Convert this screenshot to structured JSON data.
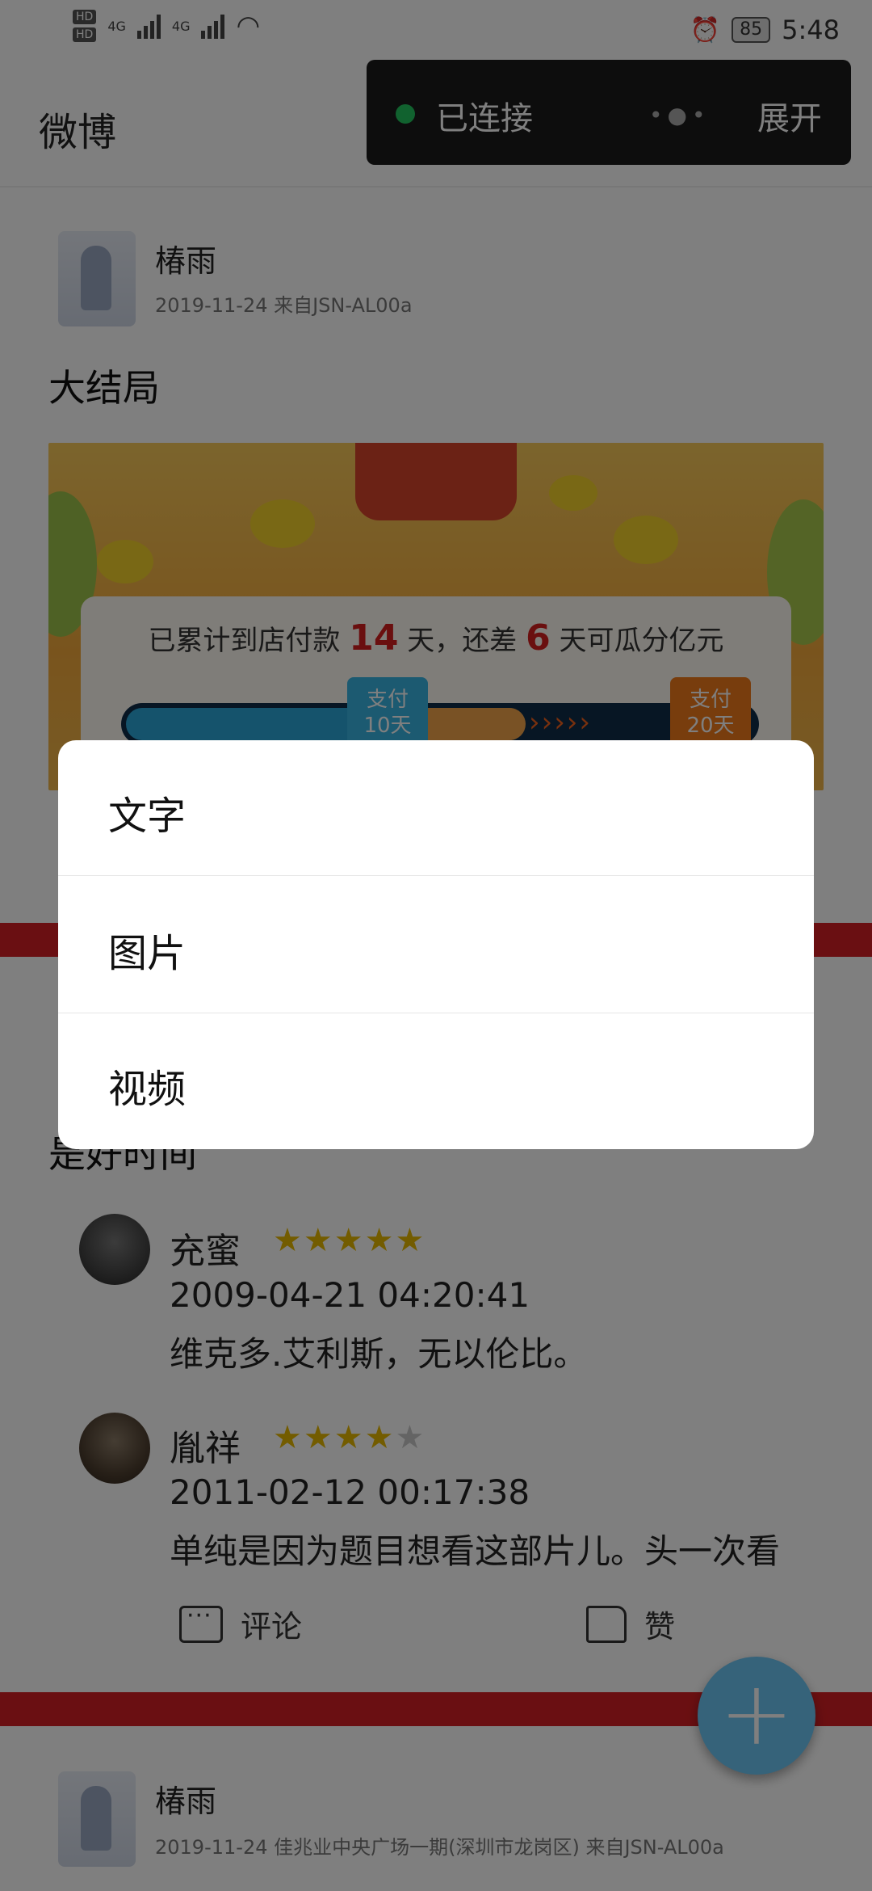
{
  "status_bar": {
    "hd1": "HD",
    "hd2": "HD",
    "sim1": "4G",
    "sim2": "4G",
    "battery": "85",
    "time": "5:48",
    "icons": [
      "signal-icon",
      "wifi-icon",
      "alarm-icon",
      "battery-icon"
    ]
  },
  "app_bar": {
    "title": "微博",
    "icon": "refresh-icon"
  },
  "toast": {
    "status": "已连接",
    "expand": "展开",
    "accent": "#22c55e"
  },
  "post1": {
    "author": "椿雨",
    "meta": "2019-11-24  来自JSN-AL00a",
    "title": "大结局",
    "banner": {
      "line_pre": "已累计到店付款",
      "days_done": "14",
      "line_mid": "天，还差",
      "days_left": "6",
      "line_post": "天可瓜分亿元",
      "tag1_a": "支付",
      "tag1_b": "10天",
      "tag2_a": "支付",
      "tag2_b": "20天"
    }
  },
  "post2": {
    "title_partial": "是好时间",
    "reviews": [
      {
        "name": "充蜜",
        "rating": 5,
        "stars_on": "★★★★★",
        "stars_off": "",
        "date": "2009-04-21 04:20:41",
        "text": "维克多.艾利斯，无以伦比。"
      },
      {
        "name": "胤祥",
        "rating": 4,
        "stars_on": "★★★★",
        "stars_off": "★",
        "date": "2011-02-12 00:17:38",
        "text": "单纯是因为题目想看这部片儿。头一次看"
      }
    ],
    "actions": {
      "comment": "评论",
      "like": "赞"
    }
  },
  "post3": {
    "author": "椿雨",
    "meta": "2019-11-24  佳兆业中央广场一期(深圳市龙岗区)  来自JSN-AL00a"
  },
  "fab": {
    "symbol": "+",
    "color": "#6cc6f5"
  },
  "dialog": {
    "options": [
      "文字",
      "图片",
      "视频"
    ]
  },
  "colors": {
    "divider_red": "#d51f24",
    "star": "#e6b800"
  }
}
